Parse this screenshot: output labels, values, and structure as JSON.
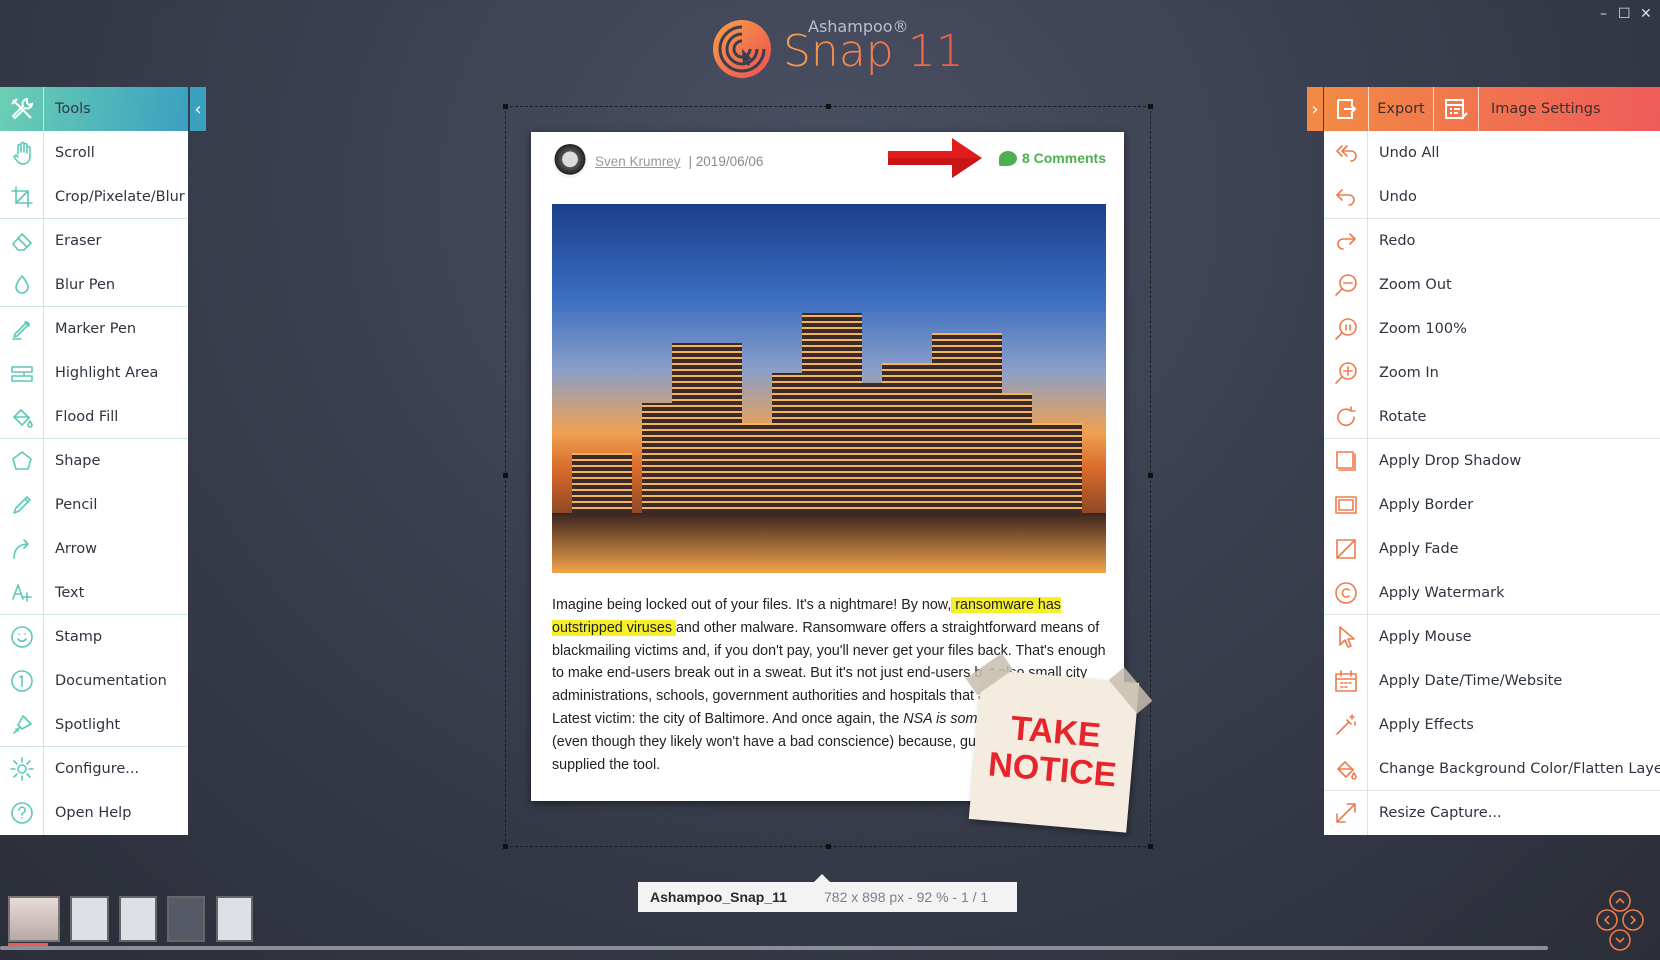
{
  "app": {
    "brand": "Ashampoo®",
    "product": "Snap 11",
    "accent_left": "#4cc0b0",
    "accent_right": "#f07a4a"
  },
  "window_controls": {
    "minimize": "–",
    "maximize": "☐",
    "close": "✕"
  },
  "left_panel": {
    "header": "Tools",
    "items": [
      {
        "label": "Scroll",
        "icon": "hand-icon"
      },
      {
        "label": "Crop/Pixelate/Blur",
        "icon": "crop-icon"
      },
      {
        "label": "Eraser",
        "icon": "eraser-icon"
      },
      {
        "label": "Blur Pen",
        "icon": "drop-icon"
      },
      {
        "label": "Marker Pen",
        "icon": "marker-icon"
      },
      {
        "label": "Highlight Area",
        "icon": "highlight-icon"
      },
      {
        "label": "Flood Fill",
        "icon": "bucket-icon"
      },
      {
        "label": "Shape",
        "icon": "pentagon-icon"
      },
      {
        "label": "Pencil",
        "icon": "pencil-icon"
      },
      {
        "label": "Arrow",
        "icon": "arrow-icon"
      },
      {
        "label": "Text",
        "icon": "text-icon"
      },
      {
        "label": "Stamp",
        "icon": "smiley-icon"
      },
      {
        "label": "Documentation",
        "icon": "number-icon"
      },
      {
        "label": "Spotlight",
        "icon": "spotlight-icon"
      },
      {
        "label": "Configure...",
        "icon": "gear-icon"
      },
      {
        "label": "Open Help",
        "icon": "help-icon"
      }
    ]
  },
  "right_panel": {
    "export": "Export",
    "image_settings": "Image Settings",
    "items": [
      {
        "label": "Undo All",
        "icon": "undo-all-icon"
      },
      {
        "label": "Undo",
        "icon": "undo-icon"
      },
      {
        "label": "Redo",
        "icon": "redo-icon"
      },
      {
        "label": "Zoom Out",
        "icon": "zoom-out-icon"
      },
      {
        "label": "Zoom 100%",
        "icon": "zoom-100-icon"
      },
      {
        "label": "Zoom In",
        "icon": "zoom-in-icon"
      },
      {
        "label": "Rotate",
        "icon": "rotate-icon"
      },
      {
        "label": "Apply Drop Shadow",
        "icon": "shadow-icon"
      },
      {
        "label": "Apply Border",
        "icon": "border-icon"
      },
      {
        "label": "Apply Fade",
        "icon": "fade-icon"
      },
      {
        "label": "Apply Watermark",
        "icon": "copyright-icon"
      },
      {
        "label": "Apply Mouse",
        "icon": "cursor-icon"
      },
      {
        "label": "Apply Date/Time/Website",
        "icon": "calendar-icon"
      },
      {
        "label": "Apply Effects",
        "icon": "magic-wand-icon"
      },
      {
        "label": "Change Background Color/Flatten Layers",
        "icon": "fill-icon"
      },
      {
        "label": "Resize Capture...",
        "icon": "resize-icon"
      }
    ]
  },
  "capture": {
    "author": "Sven Krumrey",
    "date": "| 2019/06/06",
    "comments": "8 Comments",
    "p1": "Imagine being locked out of your files. It's a nightmare! By now,",
    "p1_hl": " ransomware has outstripped viruses ",
    "p2": "and other malware. Ransomware offers a straightforward means of blackmailing victims and, if you don't pay, you'll never get your files back. That's enough to make end-users break out in a sweat. But it's not just end-users but also small city administrations, schools, government authorities and hospitals that a",
    "p3": " Latest victim: the city of Baltimore. And once again, the ",
    "p3_it": "NSA is somewh",
    "p4": " (even though they likely won't have a bad conscience) because, gues",
    "p5": " supplied the tool.",
    "sticker_line1": "TAKE",
    "sticker_line2": "NOTICE"
  },
  "status": {
    "filename": "Ashampoo_Snap_11",
    "info": "782 x 898 px - 92 % - 1 / 1"
  }
}
